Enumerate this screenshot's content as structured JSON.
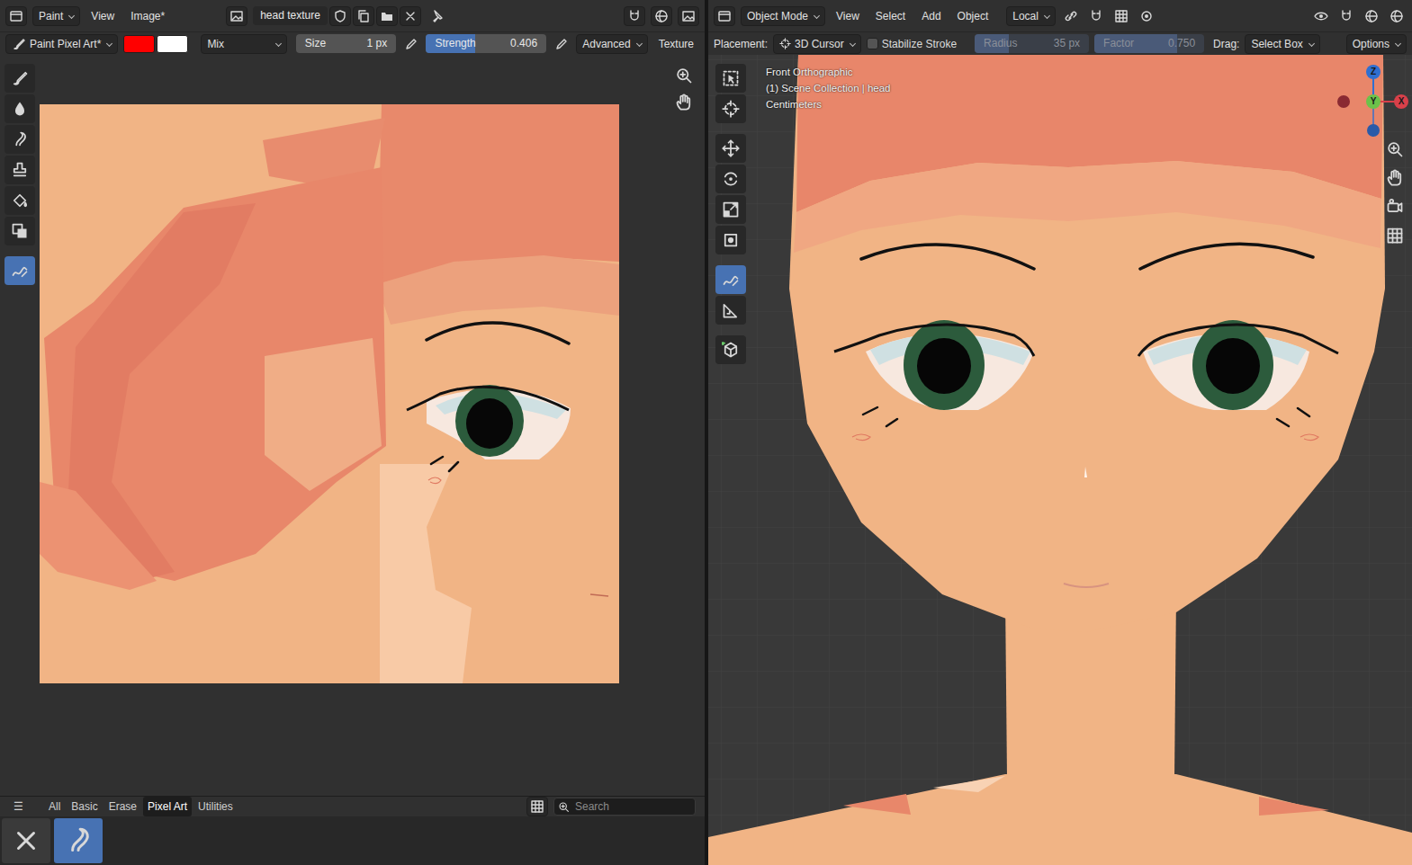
{
  "image_editor": {
    "header": {
      "mode": "Paint",
      "menus": [
        "View",
        "Image*"
      ],
      "image_name": "head texture"
    },
    "tool_settings": {
      "brush": "Paint Pixel Art*",
      "colors": [
        {
          "color": "#ff0000"
        },
        {
          "color": "#ffffff"
        }
      ],
      "blend": "Mix",
      "size": {
        "label": "Size",
        "value": "1 px"
      },
      "strength": {
        "label": "Strength",
        "value": "0.406",
        "level": 0.406
      },
      "menus": [
        "Advanced",
        "Texture"
      ]
    },
    "tools": [
      {
        "selected": false
      },
      {
        "selected": false
      },
      {
        "selected": false
      },
      {
        "selected": false
      },
      {
        "selected": false
      },
      {
        "selected": false
      },
      {
        "selected": true
      }
    ],
    "asset_shelf": {
      "menu": "☰",
      "tabs": [
        {
          "label": "All",
          "selected": false
        },
        {
          "label": "Basic",
          "selected": false
        },
        {
          "label": "Erase",
          "selected": false
        },
        {
          "label": "Pixel Art",
          "selected": true
        },
        {
          "label": "Utilities",
          "selected": false
        }
      ],
      "search": {
        "placeholder": "Search"
      },
      "assets": [
        {
          "selected": false
        },
        {
          "selected": true
        }
      ]
    }
  },
  "viewport": {
    "header": {
      "mode": "Object Mode",
      "menus": [
        "View",
        "Select",
        "Add",
        "Object"
      ],
      "orientation": "Local"
    },
    "tool_settings": {
      "placement_label": "Placement:",
      "placement": "3D Cursor",
      "stabilize": {
        "label": "Stabilize Stroke",
        "checked": false
      },
      "radius": {
        "label": "Radius",
        "value": "35 px",
        "disabled": true,
        "level": 0.3
      },
      "factor": {
        "label": "Factor",
        "value": "0.750",
        "disabled": true,
        "level": 0.75
      },
      "drag_label": "Drag:",
      "drag": "Select Box",
      "options": "Options"
    },
    "overlay": [
      "Front Orthographic",
      "(1) Scene Collection | head",
      "Centimeters"
    ],
    "gizmo": [
      {
        "label": "Z"
      },
      {
        "label": "Y"
      },
      {
        "label": "X"
      }
    ],
    "tools": [
      {
        "selected": false
      },
      {
        "selected": false
      },
      {
        "selected": false
      },
      {
        "selected": false
      },
      {
        "selected": false
      },
      {
        "selected": false
      },
      {
        "selected": true
      },
      {
        "selected": false
      },
      {
        "selected": false
      }
    ]
  }
}
